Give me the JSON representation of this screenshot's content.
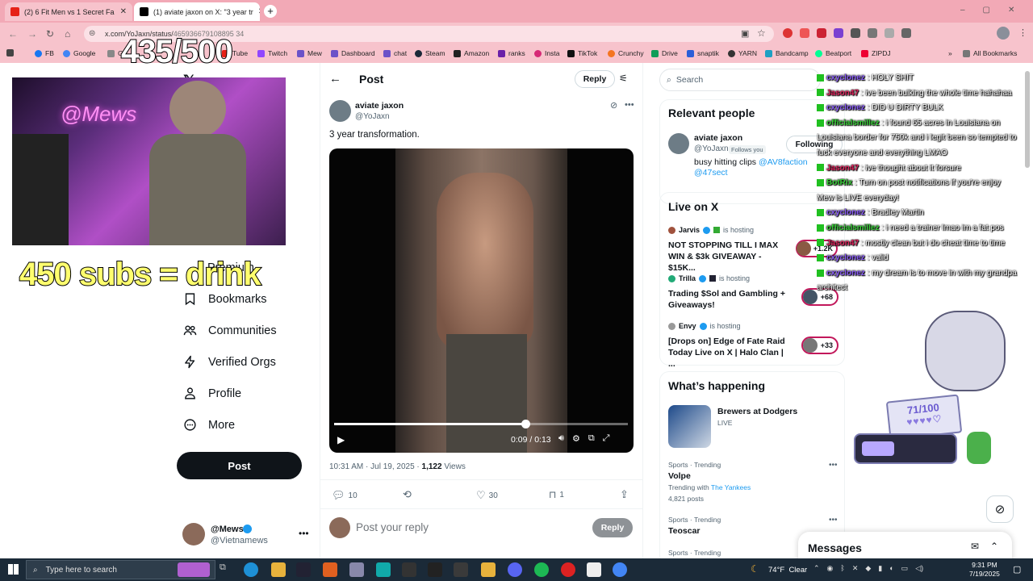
{
  "browser": {
    "tabs": [
      {
        "title": "(2) 6 Fit Men vs 1 Secret Fa",
        "active": false
      },
      {
        "title": "(1) aviate jaxon on X: \"3 year tr",
        "active": true
      }
    ],
    "url_visible": "x.com/YoJaxn/status/",
    "url_tail": "465936679108895 34",
    "bookmarks": [
      "FB",
      "Google",
      "G",
      "Tube",
      "Twitch",
      "Mew",
      "Dashboard",
      "chat",
      "Steam",
      "Amazon",
      "ranks",
      "Insta",
      "TikTok",
      "Crunchy",
      "Drive",
      "snaptik",
      "YARN",
      "Bandcamp",
      "Beatport",
      "ZIPDJ"
    ],
    "all_bookmarks": "All Bookmarks"
  },
  "overlay": {
    "counter": "435/500",
    "sub_goal": "450 subs = drink"
  },
  "sidebar": {
    "premium_partial": "Premium",
    "items": [
      {
        "label": "Bookmarks",
        "icon": "bookmark-icon"
      },
      {
        "label": "Communities",
        "icon": "communities-icon"
      },
      {
        "label": "Verified Orgs",
        "icon": "lightning-icon"
      },
      {
        "label": "Profile",
        "icon": "person-icon"
      },
      {
        "label": "More",
        "icon": "more-circle-icon"
      }
    ],
    "post_button": "Post",
    "account": {
      "name": "@Mews",
      "handle": "@Vietnamews"
    }
  },
  "post": {
    "header": "Post",
    "reply_btn": "Reply",
    "author": "aviate jaxon",
    "handle": "@YoJaxn",
    "text": "3 year transformation.",
    "video_time": "0:09 / 0:13",
    "video_progress": 0.65,
    "meta_time": "10:31 AM · Jul 19, 2025 · ",
    "views_count": "1,122",
    "views_label": " Views",
    "stats": {
      "replies": "10",
      "retweets": "",
      "likes": "30",
      "bookmarks": "1"
    },
    "reply_placeholder": "Post your reply",
    "reply_submit": "Reply"
  },
  "right": {
    "search_placeholder": "Search",
    "relevant_title": "Relevant people",
    "person": {
      "name": "aviate jaxon",
      "handle": "@YoJaxn",
      "follows_you": "Follows you",
      "following": "Following",
      "bio_prefix": "busy hitting clips ",
      "bio_link1": "@AV8faction",
      "bio_link2": "@47sect"
    },
    "live_title": "Live on X",
    "live": [
      {
        "host": "Jarvis",
        "hosting": "is hosting",
        "title": "NOT STOPPING TILL I MAX WIN & $3k GIVEAWAY - $15K...",
        "count": "+1.2K"
      },
      {
        "host": "Trilla",
        "hosting": "is hosting",
        "title": "Trading $Sol and Gambling + Giveaways!",
        "count": "+68"
      },
      {
        "host": "Envy",
        "hosting": "is hosting",
        "title": "[Drops on] Edge of Fate Raid Today Live on X | Halo Clan | ...",
        "count": "+33"
      }
    ],
    "happening_title": "What’s happening",
    "event": {
      "title": "Brewers at Dodgers",
      "status": "LIVE"
    },
    "trends": [
      {
        "cat": "Sports · Trending",
        "name": "Volpe",
        "with_prefix": "Trending with ",
        "with": "The Yankees",
        "posts": "4,821 posts"
      },
      {
        "cat": "Sports · Trending",
        "name": "Teoscar"
      },
      {
        "cat": "Sports · Trending",
        "name": ""
      }
    ],
    "messages": "Messages"
  },
  "chat": [
    {
      "user": "cxyclonez",
      "msg": " : HOLY SHIT",
      "color": "#8a5cf6"
    },
    {
      "user": "Jason47",
      "msg": " : ive been bulking the whole time hahahaa",
      "color": "#e0245e"
    },
    {
      "user": "cxyclonez",
      "msg": " : DID U DIRTY BULK",
      "color": "#8a5cf6"
    },
    {
      "user": "officialsmillez",
      "msg": " : i found 65 acres in Louisiana on",
      "color": "#3ad13a"
    },
    {
      "user": "",
      "msg": "Louisiana border for 750k and i legit been so tempted to",
      "color": "#fff"
    },
    {
      "user": "",
      "msg": "fuck everyone and everything LMAO",
      "color": "#fff"
    },
    {
      "user": "Jason47",
      "msg": " : ive thought about it forsure",
      "color": "#e0245e"
    },
    {
      "user": "BotRix",
      "msg": " : Turn on post notifications if you're enjoy",
      "color": "#3ad13a"
    },
    {
      "user": "",
      "msg": "Mew is LIVE everyday!",
      "color": "#fff"
    },
    {
      "user": "cxyclonez",
      "msg": " : Bradley Martin",
      "color": "#8a5cf6"
    },
    {
      "user": "officialsmillez",
      "msg": " : i need a trainer lmao im a fat pos",
      "color": "#3ad13a"
    },
    {
      "user": "Jason47",
      "msg": " : mostly clean but i do cheat time to time",
      "color": "#e0245e"
    },
    {
      "user": "cxyclonez",
      "msg": " : valid",
      "color": "#8a5cf6"
    },
    {
      "user": "cxyclonez",
      "msg": " : my dream is to move in with my grandpa",
      "color": "#8a5cf6"
    },
    {
      "user": "",
      "msg": "architect",
      "color": "#fff"
    }
  ],
  "goal_widget": {
    "text": "71/100"
  },
  "taskbar": {
    "search": "Type here to search",
    "weather": "74°F  Clear",
    "time": "9:31 PM",
    "date": "7/19/2025"
  }
}
